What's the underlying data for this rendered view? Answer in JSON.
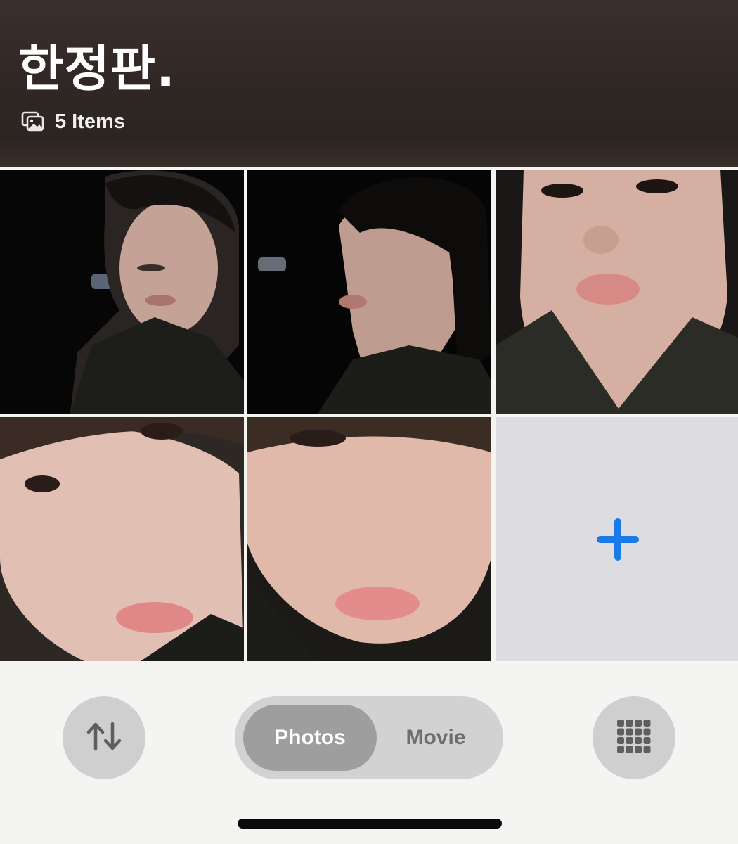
{
  "album": {
    "title": "한정판.",
    "item_count_label": "5 Items",
    "item_count_icon": "photo-stack-icon"
  },
  "grid": {
    "photos": [
      {
        "name": "photo-1",
        "description_icon": "photo"
      },
      {
        "name": "photo-2",
        "description_icon": "photo"
      },
      {
        "name": "photo-3",
        "description_icon": "photo"
      },
      {
        "name": "photo-4",
        "description_icon": "photo"
      },
      {
        "name": "photo-5",
        "description_icon": "photo"
      }
    ],
    "add_tile_icon": "plus-icon",
    "add_tile_color": "#1a7be8"
  },
  "toolbar": {
    "sort_icon": "sort-arrows-icon",
    "segments": [
      {
        "label": "Photos",
        "selected": true
      },
      {
        "label": "Movie",
        "selected": false
      }
    ],
    "view_icon": "grid-view-icon"
  },
  "colors": {
    "header_bg": "#2f2724",
    "page_bg": "#f4f4f2",
    "accent": "#1a7be8"
  }
}
